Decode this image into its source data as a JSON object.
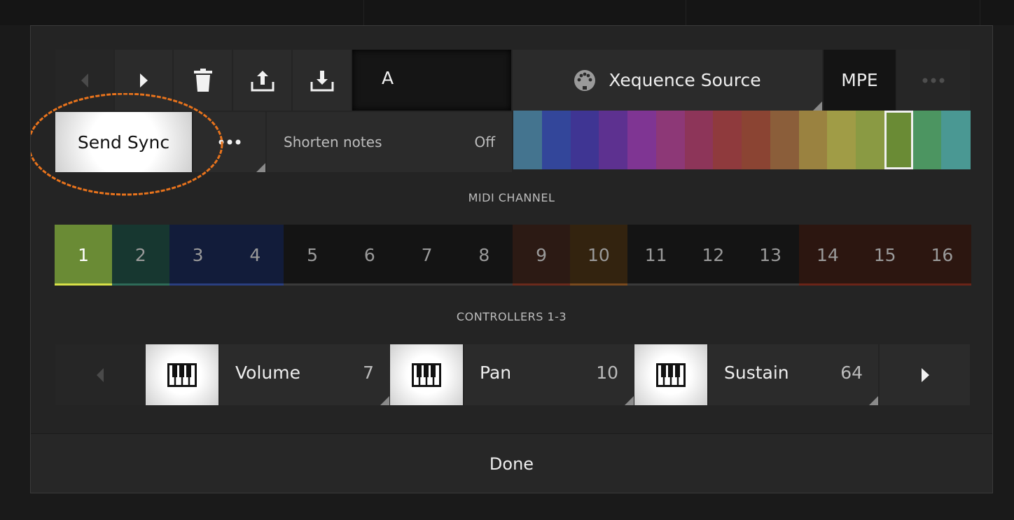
{
  "toolbar": {
    "preset_name": "A",
    "source_name": "Xequence Source",
    "mpe_label": "MPE"
  },
  "sync": {
    "send_sync_label": "Send Sync",
    "shorten_notes_label": "Shorten notes",
    "shorten_notes_value": "Off"
  },
  "colors": {
    "swatches": [
      "#44748f",
      "#33469a",
      "#3f3593",
      "#5d3190",
      "#7f3593",
      "#8d3877",
      "#8d3559",
      "#8f3a3d",
      "#8b4433",
      "#8b5e3a",
      "#9a8240",
      "#a09c46",
      "#8a9a43",
      "#6a8b35",
      "#4c9561",
      "#4a9893"
    ],
    "selected_index": 13,
    "selection_outline": "#f0f0f0",
    "annotation_circle": "#e8731c"
  },
  "midi_channel": {
    "label": "MIDI CHANNEL",
    "channels": [
      {
        "label": "1",
        "bg": "#6a8b35",
        "bar": "#d8e048",
        "text": "#ffffff"
      },
      {
        "label": "2",
        "bg": "#173730",
        "bar": "#2e6b58",
        "text": "#9a9a9a"
      },
      {
        "label": "3",
        "bg": "#121c3a",
        "bar": "#2a3f80",
        "text": "#9a9a9a"
      },
      {
        "label": "4",
        "bg": "#121c3a",
        "bar": "#2a3f80",
        "text": "#9a9a9a"
      },
      {
        "label": "5",
        "bg": "#141414",
        "bar": "#3a3a3a",
        "text": "#9a9a9a"
      },
      {
        "label": "6",
        "bg": "#141414",
        "bar": "#3a3a3a",
        "text": "#9a9a9a"
      },
      {
        "label": "7",
        "bg": "#141414",
        "bar": "#3a3a3a",
        "text": "#9a9a9a"
      },
      {
        "label": "8",
        "bg": "#141414",
        "bar": "#3a3a3a",
        "text": "#9a9a9a"
      },
      {
        "label": "9",
        "bg": "#2c1a14",
        "bar": "#6b2a1c",
        "text": "#9a9a9a"
      },
      {
        "label": "10",
        "bg": "#33230f",
        "bar": "#7a4a1e",
        "text": "#9a9a9a"
      },
      {
        "label": "11",
        "bg": "#141414",
        "bar": "#3a3a3a",
        "text": "#9a9a9a"
      },
      {
        "label": "12",
        "bg": "#141414",
        "bar": "#3a3a3a",
        "text": "#9a9a9a"
      },
      {
        "label": "13",
        "bg": "#141414",
        "bar": "#3a3a3a",
        "text": "#9a9a9a"
      },
      {
        "label": "14",
        "bg": "#2c1610",
        "bar": "#6b2418",
        "text": "#9a9a9a"
      },
      {
        "label": "15",
        "bg": "#2c1610",
        "bar": "#6b2418",
        "text": "#9a9a9a"
      },
      {
        "label": "16",
        "bg": "#2c1610",
        "bar": "#6b2418",
        "text": "#9a9a9a"
      }
    ]
  },
  "controllers": {
    "label": "CONTROLLERS 1-3",
    "items": [
      {
        "name": "Volume",
        "number": "7"
      },
      {
        "name": "Pan",
        "number": "10"
      },
      {
        "name": "Sustain",
        "number": "64"
      }
    ]
  },
  "footer": {
    "done_label": "Done"
  },
  "icons": {
    "toolbar": [
      "chevron-left-icon",
      "play-icon",
      "trash-icon",
      "export-icon",
      "import-icon",
      "midi-port-icon",
      "more-icon"
    ],
    "controllers": [
      "piano-icon",
      "chevron-right-icon"
    ]
  }
}
